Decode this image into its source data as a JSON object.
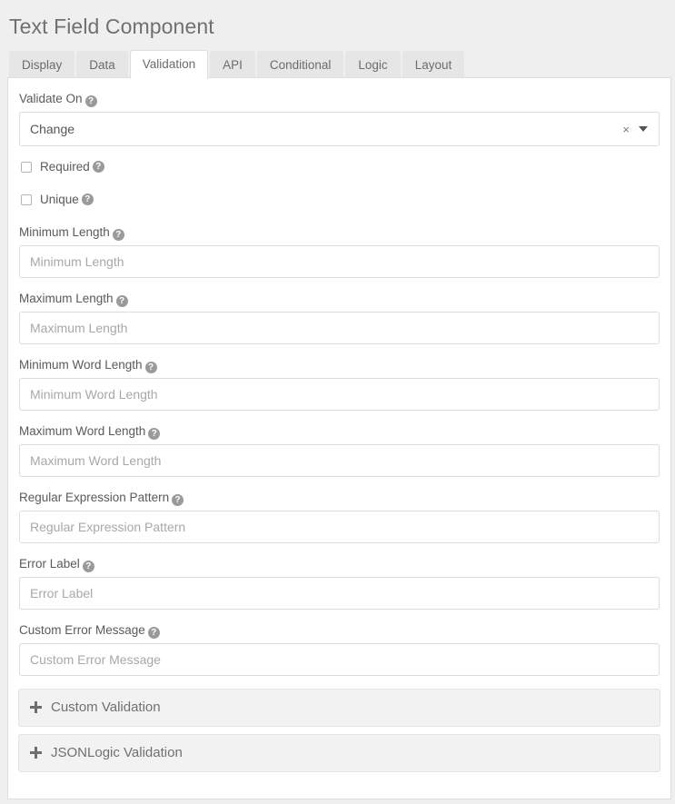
{
  "page": {
    "title": "Text Field Component"
  },
  "tabs": [
    {
      "label": "Display",
      "active": false
    },
    {
      "label": "Data",
      "active": false
    },
    {
      "label": "Validation",
      "active": true
    },
    {
      "label": "API",
      "active": false
    },
    {
      "label": "Conditional",
      "active": false
    },
    {
      "label": "Logic",
      "active": false
    },
    {
      "label": "Layout",
      "active": false
    }
  ],
  "help_glyph": "?",
  "form": {
    "validate_on": {
      "label": "Validate On",
      "value": "Change",
      "clear_glyph": "×"
    },
    "required": {
      "label": "Required",
      "checked": false
    },
    "unique": {
      "label": "Unique",
      "checked": false
    },
    "minimum_length": {
      "label": "Minimum Length",
      "placeholder": "Minimum Length",
      "value": ""
    },
    "maximum_length": {
      "label": "Maximum Length",
      "placeholder": "Maximum Length",
      "value": ""
    },
    "minimum_word_length": {
      "label": "Minimum Word Length",
      "placeholder": "Minimum Word Length",
      "value": ""
    },
    "maximum_word_length": {
      "label": "Maximum Word Length",
      "placeholder": "Maximum Word Length",
      "value": ""
    },
    "regular_expression_pattern": {
      "label": "Regular Expression Pattern",
      "placeholder": "Regular Expression Pattern",
      "value": ""
    },
    "error_label": {
      "label": "Error Label",
      "placeholder": "Error Label",
      "value": ""
    },
    "custom_error_message": {
      "label": "Custom Error Message",
      "placeholder": "Custom Error Message",
      "value": ""
    }
  },
  "accordions": [
    {
      "label": "Custom Validation",
      "expanded": false
    },
    {
      "label": "JSONLogic Validation",
      "expanded": false
    }
  ],
  "colors": {
    "page_background": "#efefef",
    "panel_background": "#ffffff",
    "border": "#dedede",
    "text": "#555555",
    "muted_text": "#a8a8a8",
    "accordion_background": "#f2f2f2"
  }
}
